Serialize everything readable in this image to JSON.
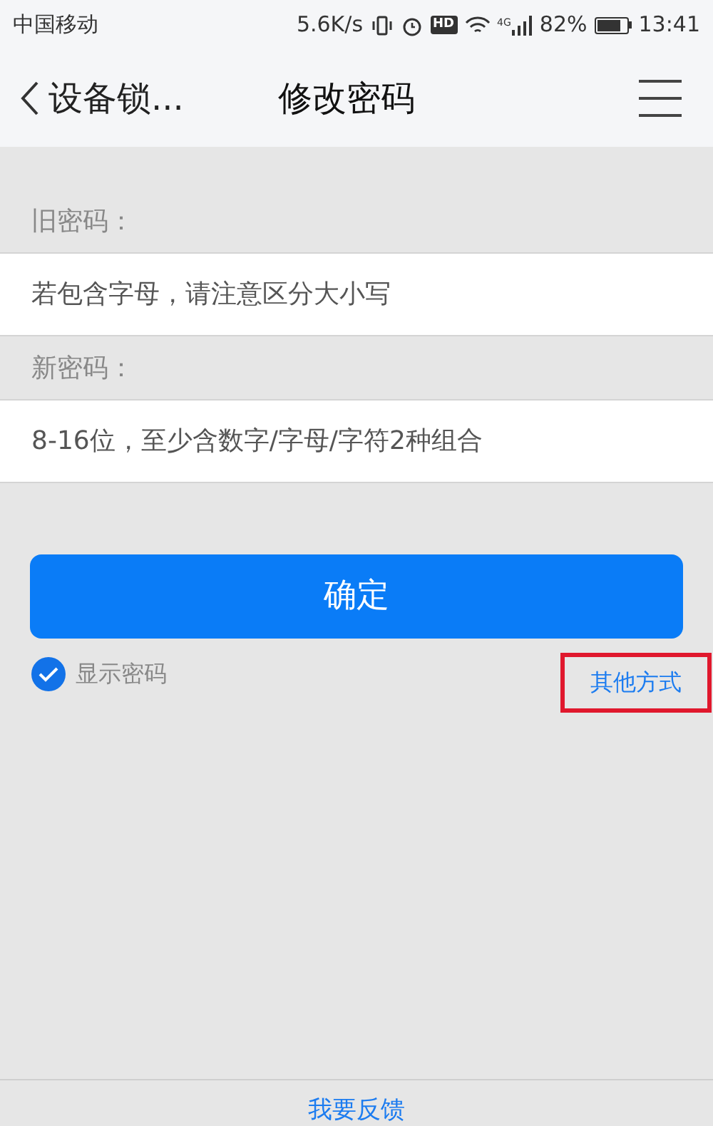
{
  "status_bar": {
    "carrier": "中国移动",
    "speed": "5.6K/s",
    "hd": "HD",
    "network": "4G",
    "battery": "82%",
    "time": "13:41"
  },
  "nav": {
    "back": "设备锁...",
    "title": "修改密码"
  },
  "fields": [
    {
      "label": "旧密码：",
      "placeholder": "若包含字母，请注意区分大小写"
    },
    {
      "label": "新密码：",
      "placeholder": "8-16位，至少含数字/字母/字符2种组合"
    }
  ],
  "confirm": "确定",
  "show_password": {
    "label": "显示密码",
    "checked": true
  },
  "other": {
    "label": "其他方式",
    "highlighted": true
  },
  "feedback": "我要反馈"
}
